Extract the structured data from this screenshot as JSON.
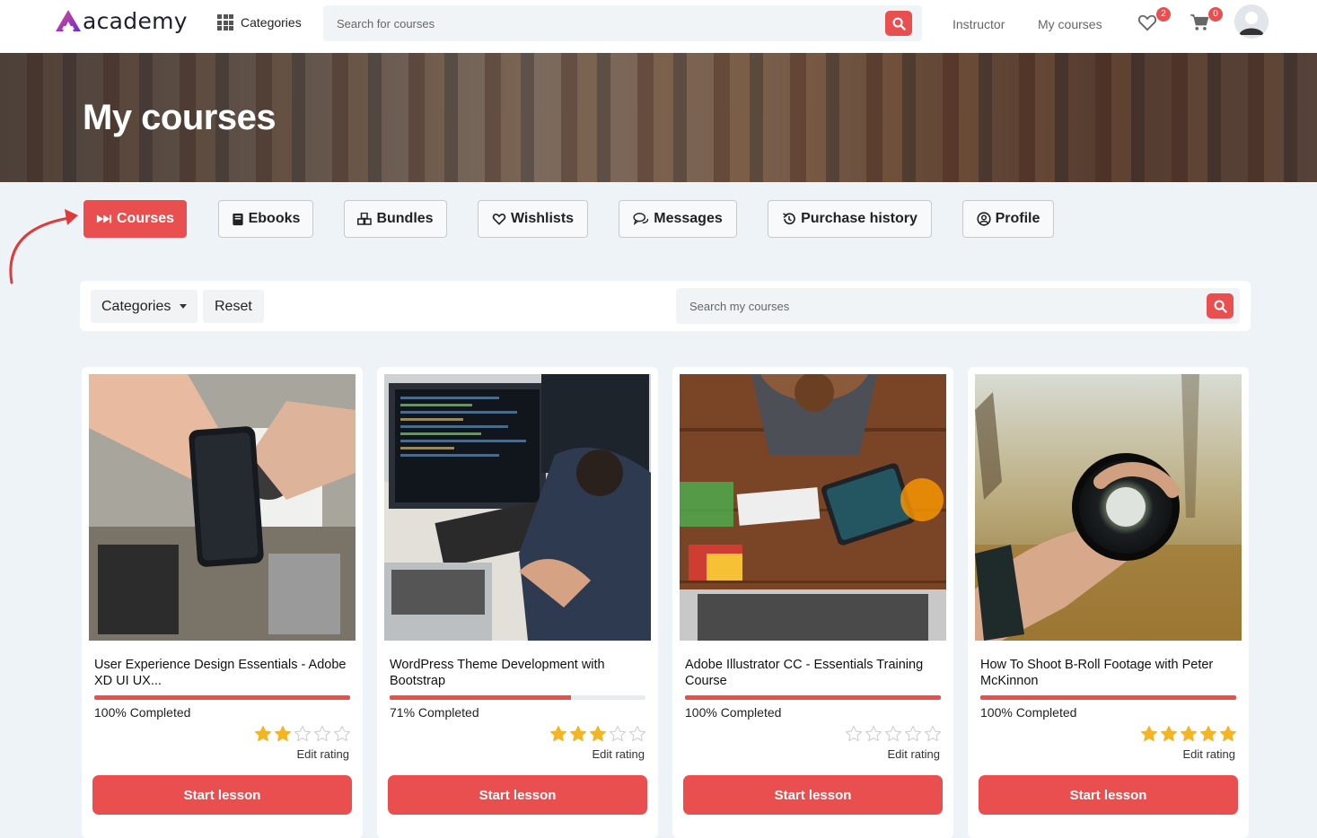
{
  "brand": {
    "name": "academy",
    "accent": "#ea4f4f"
  },
  "navbar": {
    "categories_label": "Categories",
    "search_placeholder": "Search for courses",
    "links": [
      "Instructor",
      "My courses"
    ],
    "wishlist_count": "2",
    "cart_count": "0"
  },
  "hero": {
    "title": "My courses"
  },
  "tabs": [
    {
      "label": "Courses",
      "icon": "fast-forward-icon",
      "active": true
    },
    {
      "label": "Ebooks",
      "icon": "book-icon",
      "active": false
    },
    {
      "label": "Bundles",
      "icon": "cubes-icon",
      "active": false
    },
    {
      "label": "Wishlists",
      "icon": "heart-icon",
      "active": false
    },
    {
      "label": "Messages",
      "icon": "chat-icon",
      "active": false
    },
    {
      "label": "Purchase history",
      "icon": "history-icon",
      "active": false
    },
    {
      "label": "Profile",
      "icon": "user-circle-icon",
      "active": false
    }
  ],
  "filters": {
    "categories_label": "Categories",
    "reset_label": "Reset",
    "search_placeholder": "Search my courses"
  },
  "courses": [
    {
      "title": "User Experience Design Essentials - Adobe XD UI UX...",
      "progress": 100,
      "completed_text": "100% Completed",
      "rating": 2,
      "edit_rating": "Edit rating",
      "button": "Start lesson"
    },
    {
      "title": "WordPress Theme Development with Bootstrap",
      "progress": 71,
      "completed_text": "71% Completed",
      "rating": 3,
      "edit_rating": "Edit rating",
      "button": "Start lesson"
    },
    {
      "title": "Adobe Illustrator CC - Essentials Training Course",
      "progress": 100,
      "completed_text": "100% Completed",
      "rating": 0,
      "edit_rating": "Edit rating",
      "button": "Start lesson"
    },
    {
      "title": "How To Shoot B-Roll Footage with Peter McKinnon",
      "progress": 100,
      "completed_text": "100% Completed",
      "rating": 5,
      "edit_rating": "Edit rating",
      "button": "Start lesson"
    }
  ]
}
